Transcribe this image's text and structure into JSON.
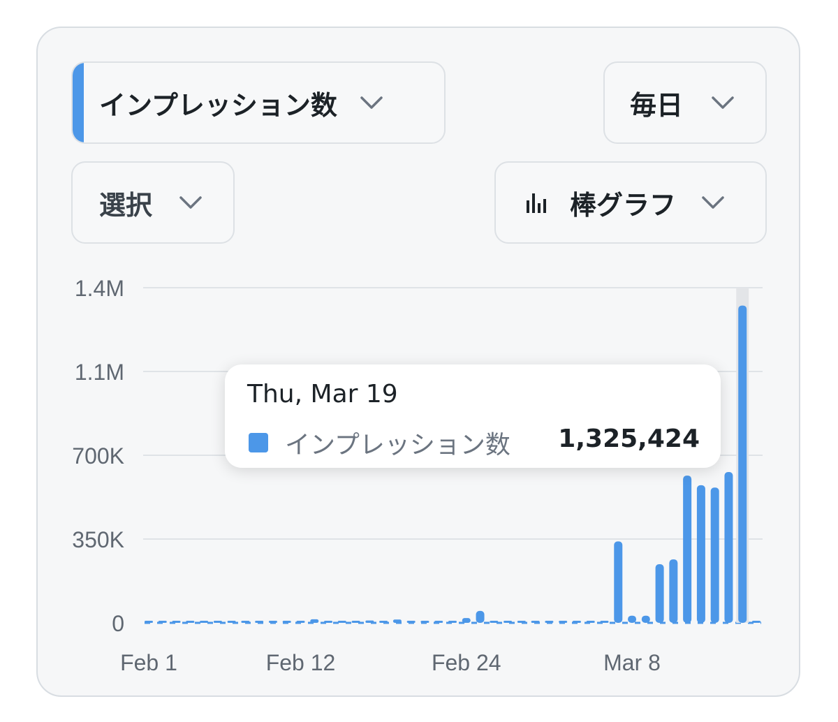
{
  "controls": {
    "metric_label": "インプレッション数",
    "interval_label": "毎日",
    "select_label": "選択",
    "chart_type_label": "棒グラフ"
  },
  "colors": {
    "accent": "#4c97e8",
    "grid": "#dfe3e7",
    "axis_text": "#5f6771",
    "highlight": "#e3e5e8"
  },
  "tooltip": {
    "date": "Thu, Mar 19",
    "series": "インプレッション数",
    "value": "1,325,424"
  },
  "chart_data": {
    "type": "bar",
    "series": [
      {
        "name": "インプレッション数",
        "values": [
          2000,
          2000,
          2000,
          2000,
          2000,
          2000,
          2000,
          2000,
          2000,
          2000,
          2000,
          2000,
          15000,
          8000,
          6000,
          8000,
          10000,
          7000,
          14000,
          7000,
          6000,
          6000,
          6000,
          20000,
          50000,
          2000,
          2000,
          2000,
          2000,
          2000,
          2000,
          2000,
          2000,
          5000,
          340000,
          30000,
          30000,
          245000,
          265000,
          615000,
          575000,
          565000,
          630000,
          1325424,
          2000
        ]
      }
    ],
    "x_ticks": [
      {
        "label": "Feb 1",
        "index": 0
      },
      {
        "label": "Feb 12",
        "index": 11
      },
      {
        "label": "Feb 24",
        "index": 23
      },
      {
        "label": "Mar 8",
        "index": 35
      }
    ],
    "y_ticks": [
      {
        "label": "0",
        "value": 0
      },
      {
        "label": "350K",
        "value": 350000
      },
      {
        "label": "700K",
        "value": 700000
      },
      {
        "label": "1.1M",
        "value": 1050000
      },
      {
        "label": "1.4M",
        "value": 1400000
      }
    ],
    "ylim": [
      0,
      1400000
    ],
    "highlighted_index": 43,
    "grid": true
  }
}
